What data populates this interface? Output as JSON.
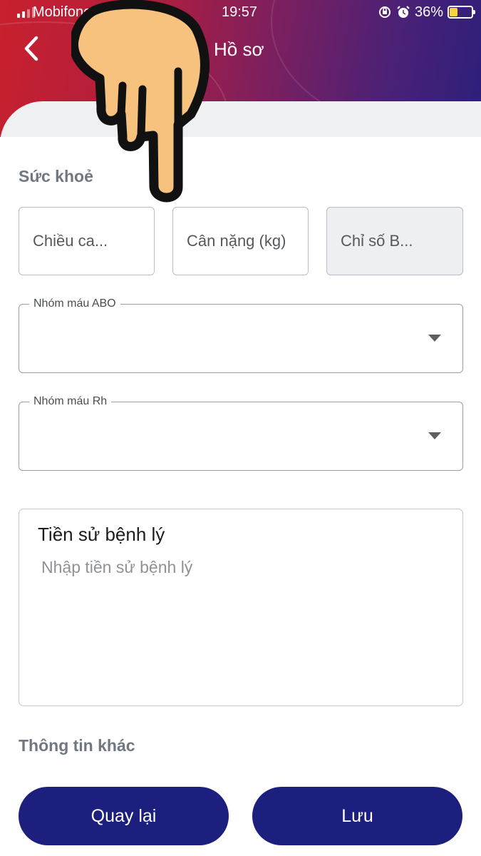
{
  "status_bar": {
    "carrier": "Mobifone",
    "time": "19:57",
    "battery_percent": "36%",
    "battery_level": 0.36,
    "icons": [
      "signal-icon",
      "orientation-lock-icon",
      "alarm-icon",
      "battery-icon"
    ]
  },
  "header": {
    "title": "Hồ sơ",
    "back_icon": "chevron-left-icon",
    "colors": {
      "gradient_start": "#c8202e",
      "gradient_end": "#2c1f7a"
    }
  },
  "health": {
    "section_title": "Sức khoẻ",
    "height_placeholder": "Chiều ca...",
    "weight_placeholder": "Cân nặng (kg)",
    "bmi_placeholder": "Chỉ số B...",
    "blood_abo": {
      "label": "Nhóm máu ABO",
      "value": "",
      "icon": "caret-down-icon"
    },
    "blood_rh": {
      "label": "Nhóm máu Rh",
      "value": "",
      "icon": "caret-down-icon"
    },
    "medical_history": {
      "label": "Tiền sử bệnh lý",
      "placeholder": "Nhập tiền sử bệnh lý",
      "value": ""
    }
  },
  "other": {
    "section_title": "Thông tin khác"
  },
  "actions": {
    "back_label": "Quay lại",
    "save_label": "Lưu",
    "button_color": "#1c1f7e"
  }
}
